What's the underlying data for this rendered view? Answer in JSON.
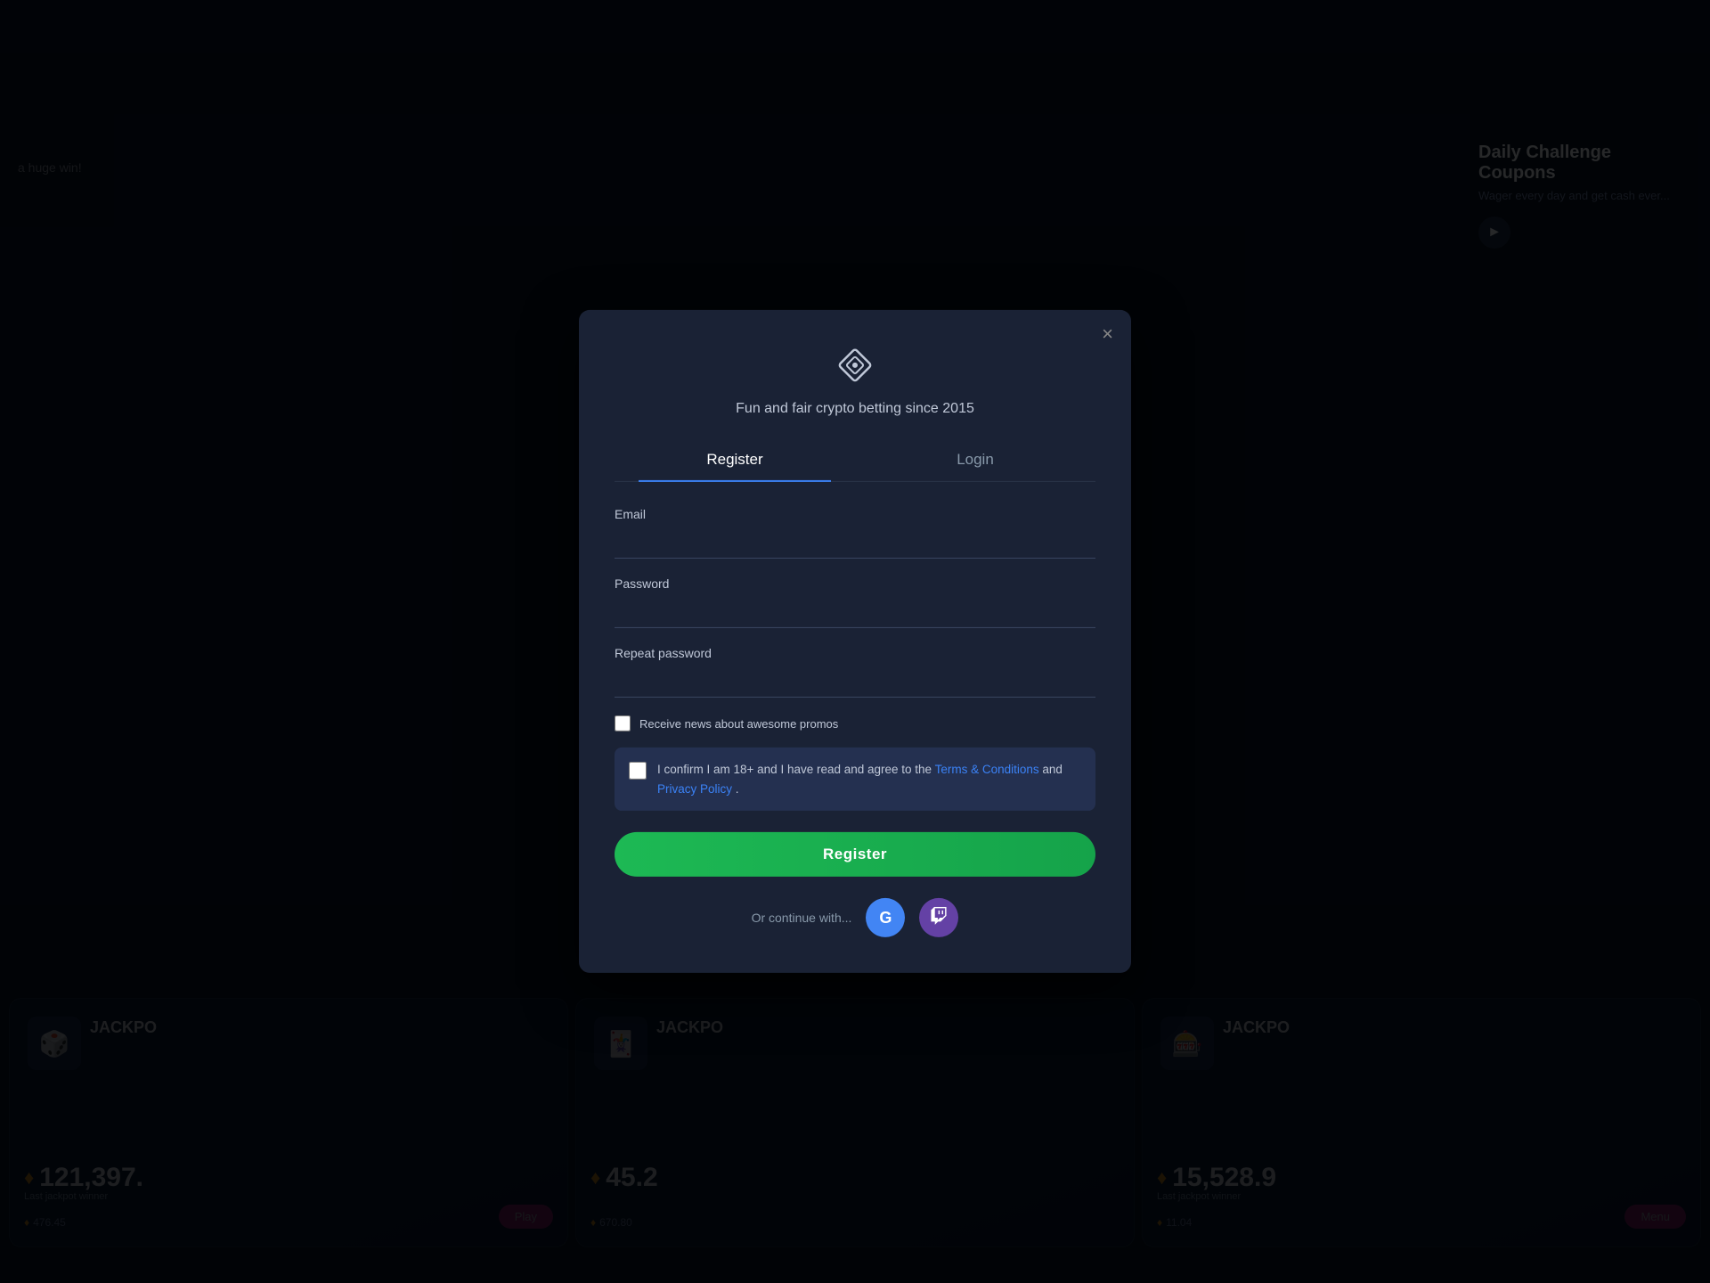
{
  "app": {
    "title": "Fun and fair crypto betting since 2015",
    "tagline": "Fun and fair crypto betting since 2015"
  },
  "modal": {
    "close_label": "×",
    "tabs": [
      {
        "id": "register",
        "label": "Register",
        "active": true
      },
      {
        "id": "login",
        "label": "Login",
        "active": false
      }
    ],
    "form": {
      "email_label": "Email",
      "email_placeholder": "",
      "password_label": "Password",
      "password_placeholder": "",
      "repeat_password_label": "Repeat password",
      "repeat_password_placeholder": "",
      "news_checkbox_label": "Receive news about awesome promos",
      "terms_text_prefix": "I confirm I am 18+ and I have read and agree to the ",
      "terms_link1": "Terms & Conditions",
      "terms_text_middle": " and ",
      "terms_link2": "Privacy Policy",
      "terms_text_suffix": " .",
      "register_button_label": "Register",
      "social_label": "Or continue with..."
    }
  },
  "social_buttons": [
    {
      "id": "google",
      "label": "G",
      "title": "Google"
    },
    {
      "id": "twitch",
      "label": "t",
      "title": "Twitch"
    }
  ],
  "background": {
    "left_text": "a huge win!",
    "jackpot_cards": [
      {
        "name": "JACKPO",
        "amount": "121,397.",
        "sub_amount": "476.45",
        "label": "Last jackpot winner",
        "play_label": "Play"
      },
      {
        "name": "JACKPO",
        "amount": "45.2",
        "sub_amount": "670.80",
        "label": "",
        "play_label": ""
      },
      {
        "name": "JACKPO",
        "amount": "15,528.9",
        "sub_amount": "11.04",
        "label": "Last jackpot winner",
        "play_label": "Menu"
      }
    ],
    "daily_challenge": {
      "title": "Daily Challenge Coupons",
      "sub": "Wager every day and get cash ever..."
    }
  },
  "colors": {
    "accent_blue": "#3b82f6",
    "accent_green": "#1db954",
    "accent_purple": "#6441a5",
    "modal_bg": "#1a2235",
    "terms_bg": "#243050"
  }
}
